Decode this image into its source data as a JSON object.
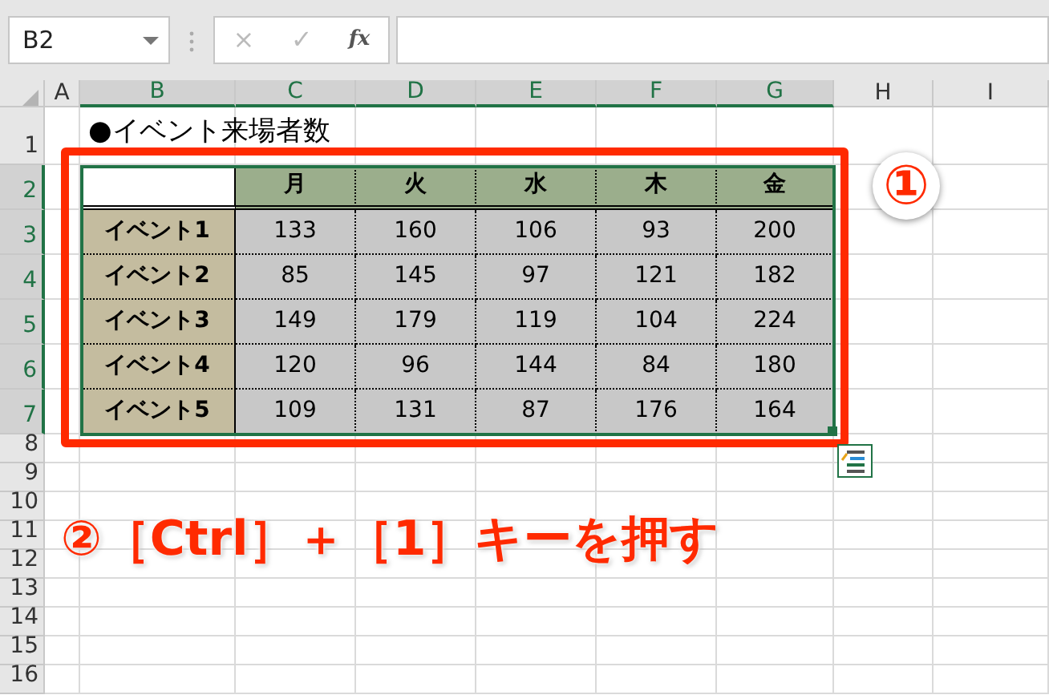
{
  "name_box": {
    "value": "B2"
  },
  "formula_buttons": [
    {
      "label": "×",
      "disabled": true
    },
    {
      "label": "✓",
      "disabled": true
    },
    {
      "label": "fx",
      "disabled": false
    }
  ],
  "columns": [
    {
      "label": "A",
      "selected": false
    },
    {
      "label": "B",
      "selected": true
    },
    {
      "label": "C",
      "selected": true
    },
    {
      "label": "D",
      "selected": true
    },
    {
      "label": "E",
      "selected": true
    },
    {
      "label": "F",
      "selected": true
    },
    {
      "label": "G",
      "selected": true
    },
    {
      "label": "H",
      "selected": false
    },
    {
      "label": "I",
      "selected": false
    }
  ],
  "rows": [
    {
      "label": "1",
      "selected": false
    },
    {
      "label": "2",
      "selected": true
    },
    {
      "label": "3",
      "selected": true
    },
    {
      "label": "4",
      "selected": true
    },
    {
      "label": "5",
      "selected": true
    },
    {
      "label": "6",
      "selected": true
    },
    {
      "label": "7",
      "selected": true
    },
    {
      "label": "8",
      "selected": false
    },
    {
      "label": "9",
      "selected": false
    },
    {
      "label": "10",
      "selected": false
    },
    {
      "label": "11",
      "selected": false
    },
    {
      "label": "12",
      "selected": false
    },
    {
      "label": "13",
      "selected": false
    },
    {
      "label": "14",
      "selected": false
    },
    {
      "label": "15",
      "selected": false
    },
    {
      "label": "16",
      "selected": false
    }
  ],
  "title": "●イベント来場者数",
  "table": {
    "columns": [
      "月",
      "火",
      "水",
      "木",
      "金"
    ],
    "rows": [
      {
        "label": "イベント1",
        "values": [
          "133",
          "160",
          "106",
          "93",
          "200"
        ]
      },
      {
        "label": "イベント2",
        "values": [
          "85",
          "145",
          "97",
          "121",
          "182"
        ]
      },
      {
        "label": "イベント3",
        "values": [
          "149",
          "179",
          "119",
          "104",
          "224"
        ]
      },
      {
        "label": "イベント4",
        "values": [
          "120",
          "96",
          "144",
          "84",
          "180"
        ]
      },
      {
        "label": "イベント5",
        "values": [
          "109",
          "131",
          "87",
          "176",
          "164"
        ]
      }
    ]
  },
  "annotations": {
    "step_1": "①",
    "step_2": "②［Ctrl］＋［1］キーを押す"
  }
}
